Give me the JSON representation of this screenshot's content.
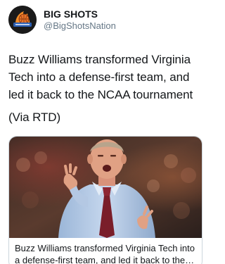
{
  "account": {
    "display_name": "BIG SHOTS",
    "handle": "@BigShotsNation",
    "avatar_icon": "big-shots-logo-icon"
  },
  "tweet": {
    "text": "Buzz Williams transformed Virginia Tech into a defense-first team, and led it back to the NCAA tournament",
    "via": "(Via RTD)"
  },
  "link_card": {
    "title": "Buzz Williams transformed Virginia Tech into a defense-first team, and led it back to the NC..."
  },
  "colors": {
    "text": "#14171a",
    "secondary_text": "#657786",
    "card_border": "#ccd6dd",
    "logo_orange": "#f28c28",
    "logo_blue": "#2b5fb4"
  }
}
